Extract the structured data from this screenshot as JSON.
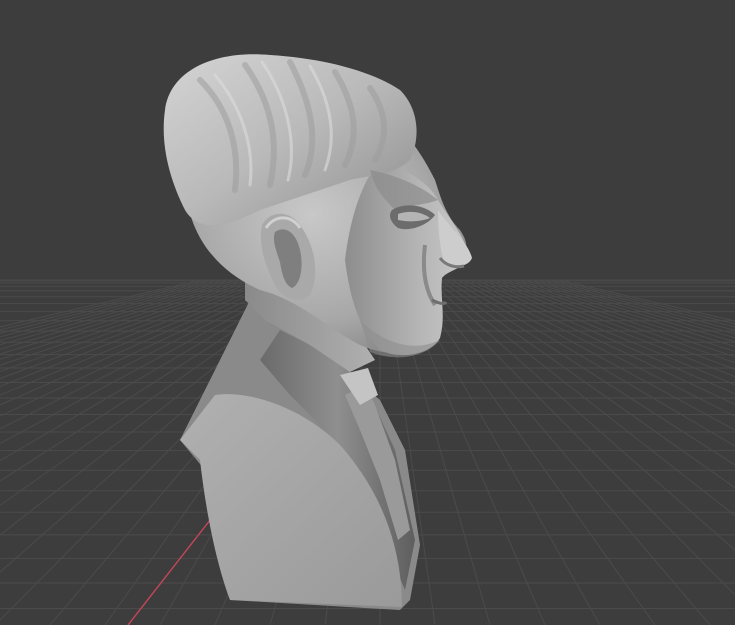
{
  "viewport": {
    "background_color": "#3d3d3d",
    "grid_color": "#4b4b4b",
    "x_axis_color": "#c8465a",
    "object": {
      "name": "sculpted-bust",
      "shading": "solid-gray",
      "base_color": "#9d9d9d"
    }
  }
}
